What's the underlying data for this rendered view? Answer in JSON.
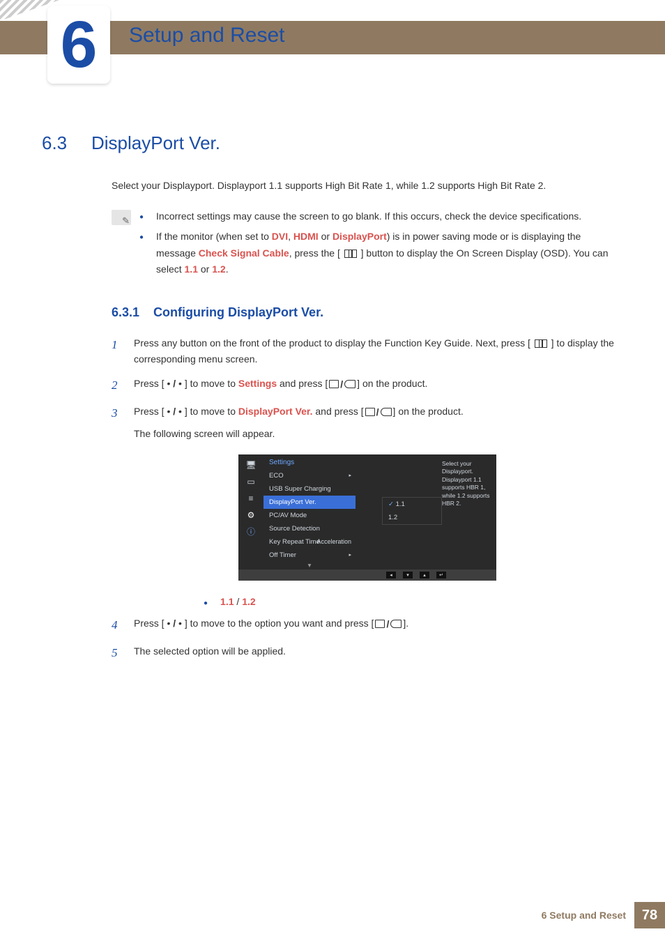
{
  "chapter": {
    "num": "6",
    "title": "Setup and Reset"
  },
  "section": {
    "num": "6.3",
    "title": "DisplayPort Ver."
  },
  "intro": "Select your Displayport. Displayport 1.1 supports High Bit Rate 1, while 1.2 supports High Bit Rate 2.",
  "callout": {
    "item1": "Incorrect settings may cause the screen to go blank. If this occurs, check the device specifications.",
    "item2_a": "If the monitor (when set to ",
    "item2_dvi": "DVI",
    "item2_c1": ", ",
    "item2_hdmi": "HDMI",
    "item2_c2": " or ",
    "item2_dp": "DisplayPort",
    "item2_b": ") is in power saving mode or is displaying the message ",
    "item2_csc": "Check Signal Cable",
    "item2_c": ", press the [ ",
    "item2_d": " ] button to display the On Screen Display (OSD). You can select ",
    "item2_v1": "1.1",
    "item2_or": " or ",
    "item2_v2": "1.2",
    "item2_e": "."
  },
  "subsection": {
    "num": "6.3.1",
    "title": "Configuring DisplayPort Ver."
  },
  "steps": {
    "s1a": "Press any button on the front of the product to display the Function Key Guide. Next, press [ ",
    "s1b": " ] to display the corresponding menu screen.",
    "s2a": "Press [ ",
    "s2b": " ] to move to ",
    "s2_settings": "Settings",
    "s2c": " and press [",
    "s2d": "] on the product.",
    "s3a": "Press [ ",
    "s3b": " ] to move to ",
    "s3_dp": "DisplayPort Ver.",
    "s3c": " and press [",
    "s3d": "] on the product.",
    "s3e": "The following screen will appear.",
    "vals_1": "1.1",
    "vals_sep": " / ",
    "vals_2": "1.2",
    "s4a": "Press [ ",
    "s4b": " ] to move to the option you want and press [",
    "s4c": "].",
    "s5": "The selected option will be applied."
  },
  "osd": {
    "heading": "Settings",
    "items": {
      "eco": "ECO",
      "usb": "USB Super Charging",
      "dp": "DisplayPort Ver.",
      "pcav": "PC/AV Mode",
      "source": "Source Detection",
      "krt": "Key Repeat Time",
      "krt_val": "Acceleration",
      "off": "Off Timer"
    },
    "dd": {
      "v11": "1.1",
      "v12": "1.2"
    },
    "desc": "Select your Displayport. Displayport 1.1 supports HBR 1, while 1.2 supports HBR 2."
  },
  "footer": {
    "label": "6 Setup and Reset",
    "page": "78"
  },
  "nums": {
    "n1": "1",
    "n2": "2",
    "n3": "3",
    "n4": "4",
    "n5": "5"
  }
}
